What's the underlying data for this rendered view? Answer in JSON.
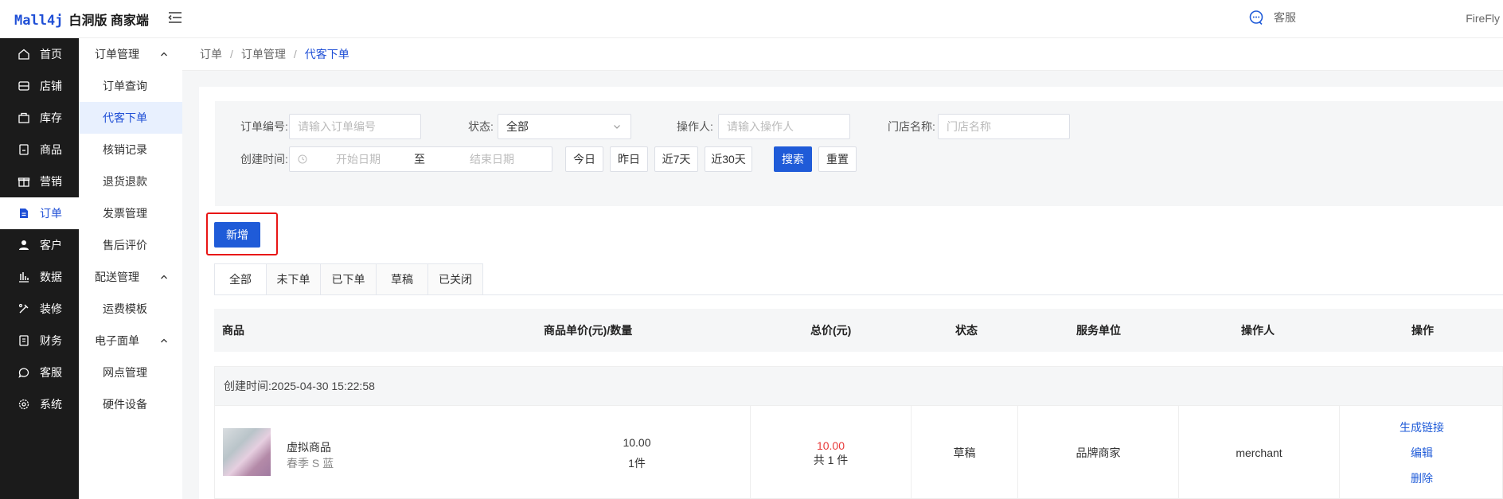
{
  "header": {
    "logo_brand": "Mall4j",
    "logo_sub": "白洞版 商家端",
    "customer_service": "客服",
    "user": "FireFly"
  },
  "sidebar": {
    "items": [
      {
        "label": "首页",
        "icon": "home-icon"
      },
      {
        "label": "店铺",
        "icon": "store-icon"
      },
      {
        "label": "库存",
        "icon": "inventory-icon"
      },
      {
        "label": "商品",
        "icon": "product-icon"
      },
      {
        "label": "营销",
        "icon": "gift-icon"
      },
      {
        "label": "订单",
        "icon": "order-icon"
      },
      {
        "label": "客户",
        "icon": "user-icon"
      },
      {
        "label": "数据",
        "icon": "chart-icon"
      },
      {
        "label": "装修",
        "icon": "decorate-icon"
      },
      {
        "label": "财务",
        "icon": "finance-icon"
      },
      {
        "label": "客服",
        "icon": "chat-icon"
      },
      {
        "label": "系统",
        "icon": "gear-icon"
      }
    ],
    "active_index": 5
  },
  "subnav": {
    "groups": [
      {
        "label": "订单管理",
        "items": [
          "订单查询",
          "代客下单",
          "核销记录",
          "退货退款",
          "发票管理",
          "售后评价"
        ]
      },
      {
        "label": "配送管理",
        "items": [
          "运费模板"
        ]
      },
      {
        "label": "电子面单",
        "items": [
          "网点管理",
          "硬件设备"
        ]
      }
    ],
    "active_item": "代客下单"
  },
  "breadcrumb": [
    "订单",
    "订单管理",
    "代客下单"
  ],
  "filter": {
    "order_no_label": "订单编号:",
    "order_no_placeholder": "请输入订单编号",
    "status_label": "状态:",
    "status_value": "全部",
    "operator_label": "操作人:",
    "operator_placeholder": "请输入操作人",
    "store_label": "门店名称:",
    "store_placeholder": "门店名称",
    "created_label": "创建时间:",
    "start_placeholder": "开始日期",
    "range_sep": "至",
    "end_placeholder": "结束日期",
    "quick": [
      "今日",
      "昨日",
      "近7天",
      "近30天"
    ],
    "search": "搜索",
    "reset": "重置"
  },
  "add_button": "新增",
  "tabs": [
    "全部",
    "未下单",
    "已下单",
    "草稿",
    "已关闭"
  ],
  "active_tab": 0,
  "table": {
    "headers": [
      "商品",
      "商品单价(元)/数量",
      "总价(元)",
      "状态",
      "服务单位",
      "操作人",
      "操作"
    ],
    "order": {
      "created": "创建时间:2025-04-30 15:22:58",
      "product_name": "虚拟商品",
      "product_sku": "春季 S 蓝",
      "unit_price": "10.00",
      "quantity": "1件",
      "total": "10.00",
      "total_count": "共 1 件",
      "status": "草稿",
      "service_unit": "品牌商家",
      "operator": "merchant",
      "actions": [
        "生成链接",
        "编辑",
        "删除"
      ]
    }
  },
  "colors": {
    "primary": "#1f5bd8",
    "sidebar_bg": "#1b1b1b",
    "price_red": "#e83a3a",
    "highlight_border": "#e81515"
  }
}
